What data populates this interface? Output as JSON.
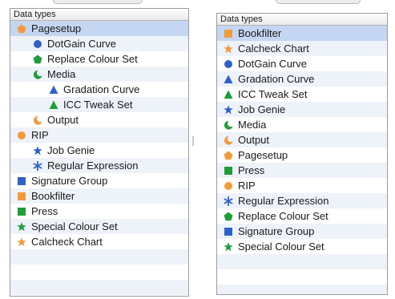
{
  "panels": [
    {
      "header": "Data types",
      "items": [
        {
          "label": "Pagesetup",
          "icon": "pentagon-icon",
          "color": "#f29b3c",
          "indent": 0,
          "selected": true
        },
        {
          "label": "DotGain Curve",
          "icon": "circle-icon",
          "color": "#2e62c9",
          "indent": 1
        },
        {
          "label": "Replace Colour Set",
          "icon": "pentagon-icon",
          "color": "#1f9d3a",
          "indent": 1
        },
        {
          "label": "Media",
          "icon": "crescent-icon",
          "color": "#1f9d3a",
          "indent": 1
        },
        {
          "label": "Gradation Curve",
          "icon": "triangle-icon",
          "color": "#2e62c9",
          "indent": 2
        },
        {
          "label": "ICC Tweak Set",
          "icon": "triangle-icon",
          "color": "#1f9d3a",
          "indent": 2
        },
        {
          "label": "Output",
          "icon": "crescent-icon",
          "color": "#f29b3c",
          "indent": 1
        },
        {
          "label": "RIP",
          "icon": "circle-icon",
          "color": "#f29b3c",
          "indent": 0
        },
        {
          "label": "Job Genie",
          "icon": "star-icon",
          "color": "#2e62c9",
          "indent": 1
        },
        {
          "label": "Regular Expression",
          "icon": "asterisk-icon",
          "color": "#2e62c9",
          "indent": 1
        },
        {
          "label": "Signature Group",
          "icon": "square-icon",
          "color": "#2e62c9",
          "indent": 0
        },
        {
          "label": "Bookfilter",
          "icon": "square-icon",
          "color": "#f29b3c",
          "indent": 0
        },
        {
          "label": "Press",
          "icon": "square-icon",
          "color": "#1f9d3a",
          "indent": 0
        },
        {
          "label": "Special Colour Set",
          "icon": "star-icon",
          "color": "#1f9d3a",
          "indent": 0
        },
        {
          "label": "Calcheck Chart",
          "icon": "star-icon",
          "color": "#f29b3c",
          "indent": 0
        }
      ]
    },
    {
      "header": "Data types",
      "items": [
        {
          "label": "Bookfilter",
          "icon": "square-icon",
          "color": "#f29b3c",
          "indent": 0,
          "selected": true
        },
        {
          "label": "Calcheck Chart",
          "icon": "star-icon",
          "color": "#f29b3c",
          "indent": 0
        },
        {
          "label": "DotGain Curve",
          "icon": "circle-icon",
          "color": "#2e62c9",
          "indent": 0
        },
        {
          "label": "Gradation Curve",
          "icon": "triangle-icon",
          "color": "#2e62c9",
          "indent": 0
        },
        {
          "label": "ICC Tweak Set",
          "icon": "triangle-icon",
          "color": "#1f9d3a",
          "indent": 0
        },
        {
          "label": "Job Genie",
          "icon": "star-icon",
          "color": "#2e62c9",
          "indent": 0
        },
        {
          "label": "Media",
          "icon": "crescent-icon",
          "color": "#1f9d3a",
          "indent": 0
        },
        {
          "label": "Output",
          "icon": "crescent-icon",
          "color": "#f29b3c",
          "indent": 0
        },
        {
          "label": "Pagesetup",
          "icon": "pentagon-icon",
          "color": "#f29b3c",
          "indent": 0
        },
        {
          "label": "Press",
          "icon": "square-icon",
          "color": "#1f9d3a",
          "indent": 0
        },
        {
          "label": "RIP",
          "icon": "circle-icon",
          "color": "#f29b3c",
          "indent": 0
        },
        {
          "label": "Regular Expression",
          "icon": "asterisk-icon",
          "color": "#2e62c9",
          "indent": 0
        },
        {
          "label": "Replace Colour Set",
          "icon": "pentagon-icon",
          "color": "#1f9d3a",
          "indent": 0
        },
        {
          "label": "Signature Group",
          "icon": "square-icon",
          "color": "#2e62c9",
          "indent": 0
        },
        {
          "label": "Special Colour Set",
          "icon": "star-icon",
          "color": "#1f9d3a",
          "indent": 0
        }
      ]
    }
  ]
}
